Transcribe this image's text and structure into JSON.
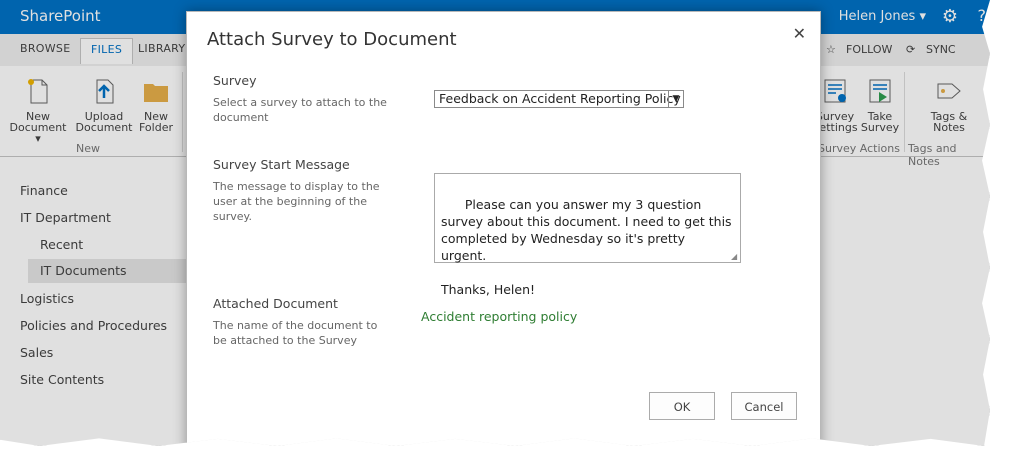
{
  "suitebar": {
    "brand": "SharePoint",
    "user": "Helen Jones ▾"
  },
  "tabs": {
    "browse": "BROWSE",
    "files": "FILES",
    "library": "LIBRARY",
    "follow": "FOLLOW",
    "sync": "SYNC"
  },
  "ribbon": {
    "new_document": [
      "New",
      "Document ▾"
    ],
    "upload_document": [
      "Upload",
      "Document"
    ],
    "new_folder": [
      "New",
      "Folder"
    ],
    "new_group": "New",
    "survey_settings": [
      "Survey",
      "Settings"
    ],
    "take_survey": [
      "Take",
      "Survey"
    ],
    "survey_actions": "Survey Actions",
    "tags_notes": [
      "Tags &",
      "Notes"
    ],
    "tags_notes_group": "Tags and Notes"
  },
  "nav": [
    "Finance",
    "IT Department",
    "Recent",
    "IT Documents",
    "Logistics",
    "Policies and Procedures",
    "Sales",
    "Site Contents"
  ],
  "dialog": {
    "title": "Attach Survey to Document",
    "close": "✕",
    "survey_label": "Survey",
    "survey_desc": "Select a survey to attach to the document",
    "survey_value": "Feedback on Accident Reporting Policy",
    "message_label": "Survey Start Message",
    "message_desc": "The message to display to the user at the beginning of the survey.",
    "message_value": "Please can you answer my 3 question survey about this document. I need to get this completed by Wednesday so it's pretty urgent.\n\nThanks, Helen!",
    "doc_label": "Attached Document",
    "doc_desc": "The name of the document to be attached to the Survey",
    "doc_value": "Accident reporting policy",
    "ok": "OK",
    "cancel": "Cancel"
  },
  "colors": {
    "suitebar": "#0072c6",
    "link_green": "#2e7d32"
  }
}
